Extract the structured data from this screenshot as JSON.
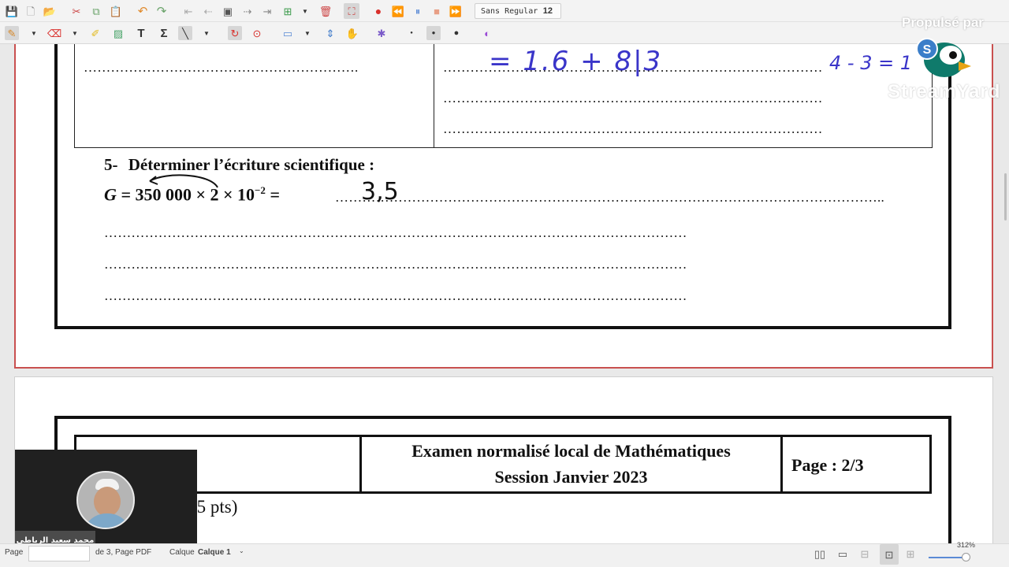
{
  "toolbar": {
    "font_name": "Sans Regular",
    "font_size": "12"
  },
  "watermark": {
    "propose": "Propulsé par",
    "brand": "StreamYard"
  },
  "page1": {
    "dots_top_left": "…………………………………………………….",
    "dots_top_right_1": "…………………………………………………………………………",
    "dots_top_right_2": "…………………………………………………………………………",
    "dots_top_right_3": "…………………………………………………………………………",
    "question_number": "5-",
    "question_text": "Déterminer l’écriture scientifique :",
    "expr_lhs": "G = ",
    "expr_body": "350 000 × 2 × 10",
    "expr_exp": "−2",
    "expr_eq": " =",
    "expr_dots": "…………………………………………………………………………………………………………..",
    "dots_line_2": "…………………………………………………………………………………………………………………",
    "dots_line_3": "…………………………………………………………………………………………………………………",
    "dots_line_4": "…………………………………………………………………………………………………………………"
  },
  "handwriting": {
    "top_expr": "= 1.6 + 8|3",
    "top_right": "4 - 3 = 1",
    "g_answer": "3,5",
    "ink_color": "#3a35c9"
  },
  "page2": {
    "header_title": "Examen normalisé local de Mathématiques",
    "header_session": "Session Janvier 2023",
    "header_page": "Page : 2/3",
    "pts_fragment": "(5 pts)"
  },
  "webcam": {
    "presenter_name": "محمد سعيد الرياطي"
  },
  "statusbar": {
    "page_label": "Page",
    "page_info": "de 3, Page PDF",
    "layer_label": "Calque",
    "layer_value": "Calque 1",
    "zoom": "312%"
  },
  "colors": {
    "record_red": "#d9302c",
    "accent_blue": "#5b8bd6"
  }
}
